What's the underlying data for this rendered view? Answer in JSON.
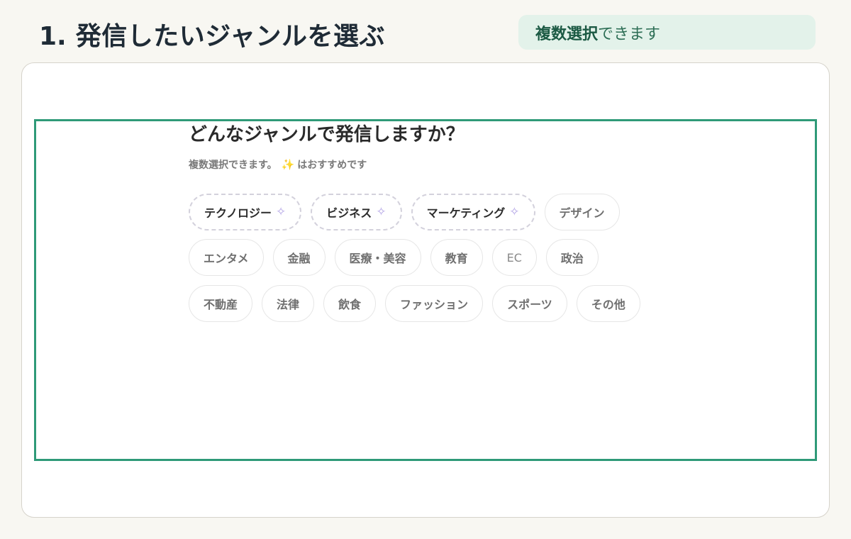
{
  "header": {
    "step_number": "1.",
    "step_title": "発信したいジャンルを選ぶ",
    "hint_strong": "複数選択",
    "hint_rest": "できます"
  },
  "panel": {
    "question": "どんなジャンルで発信しますか？",
    "subtitle_before": "複数選択できます。",
    "subtitle_emoji": "✨",
    "subtitle_after": "はおすすめです"
  },
  "genres": {
    "row1": [
      {
        "label": "テクノロジー",
        "recommended": true
      },
      {
        "label": "ビジネス",
        "recommended": true
      },
      {
        "label": "マーケティング",
        "recommended": true
      },
      {
        "label": "デザイン",
        "recommended": false
      }
    ],
    "row2": [
      {
        "label": "エンタメ",
        "recommended": false
      },
      {
        "label": "金融",
        "recommended": false
      },
      {
        "label": "医療・美容",
        "recommended": false
      },
      {
        "label": "教育",
        "recommended": false
      },
      {
        "label": "EC",
        "recommended": false
      },
      {
        "label": "政治",
        "recommended": false
      }
    ],
    "row3": [
      {
        "label": "不動産",
        "recommended": false
      },
      {
        "label": "法律",
        "recommended": false
      },
      {
        "label": "飲食",
        "recommended": false
      },
      {
        "label": "ファッション",
        "recommended": false
      },
      {
        "label": "スポーツ",
        "recommended": false
      },
      {
        "label": "その他",
        "recommended": false
      }
    ]
  },
  "icons": {
    "recommended_marker": "✧"
  },
  "colors": {
    "accent_frame": "#2f9a78",
    "hint_background": "#e3f2ea",
    "hint_text": "#1c5a44",
    "page_background": "#f8f7f2"
  }
}
